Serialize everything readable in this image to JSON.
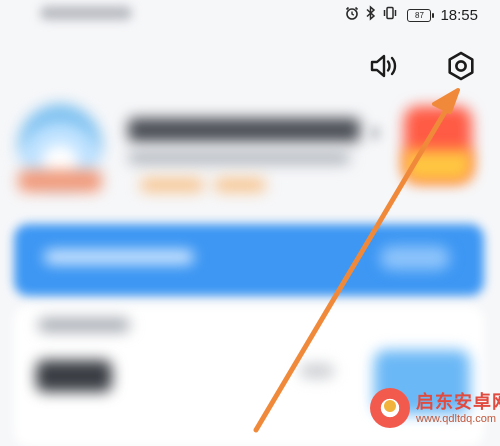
{
  "status_bar": {
    "battery": "87",
    "time": "18:55",
    "icons": [
      "alarm-icon",
      "bluetooth-icon",
      "vibrate-icon",
      "battery-icon"
    ]
  },
  "toolbar": {
    "icons": [
      "speaker-icon",
      "settings-gear-icon"
    ]
  },
  "annotation": {
    "arrow_color": "#f08a3a"
  },
  "watermark": {
    "title": "启东安卓网",
    "url": "www.qdltdq.com"
  },
  "colors": {
    "accent": "#3d97f3",
    "arrow": "#f08a3a",
    "calendar_red": "#ff5b45",
    "calendar_yellow": "#ffc642"
  }
}
